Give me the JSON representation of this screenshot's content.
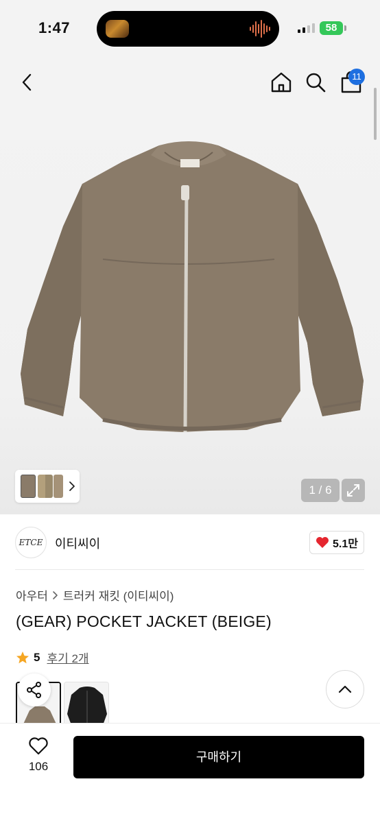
{
  "status_bar": {
    "time": "1:47",
    "battery": "58"
  },
  "header": {
    "cart_count": "11",
    "icons": [
      "back-chevron-icon",
      "home-icon",
      "search-icon",
      "cart-icon"
    ]
  },
  "gallery": {
    "counter": "1 / 6",
    "current_image": 1,
    "total_images": 6
  },
  "brand": {
    "logo_text": "ETCE",
    "name": "이티씨이",
    "likes": "5.1만"
  },
  "breadcrumb": {
    "category": "아우터",
    "subcategory": "트러커 재킷 (이티씨이)"
  },
  "product": {
    "title": "(GEAR) POCKET JACKET (BEIGE)",
    "rating": "5",
    "reviews": "후기 2개"
  },
  "colors": {
    "accent": "#1e6fe0",
    "heart": "#e5262f",
    "star": "#f5a623",
    "jacket": "#8a7b69"
  },
  "bottom_bar": {
    "wish_count": "106",
    "buy_label": "구매하기"
  }
}
